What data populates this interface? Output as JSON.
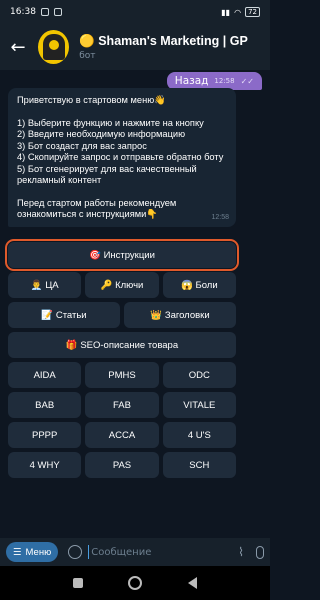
{
  "status": {
    "time": "16:38",
    "battery": "72"
  },
  "header": {
    "title": "🟡 Shaman's Marketing | GP",
    "subtitle": "бот"
  },
  "out_message": {
    "text": "Назад",
    "time": "12:58"
  },
  "in_message": {
    "greeting": "Приветствую в стартовом меню👋",
    "steps": [
      "1) Выберите функцию и нажмите на кнопку",
      "2) Введите необходимую информацию",
      "3) Бот создаст для вас запрос",
      "4) Скопируйте запрос и отправьте обратно боту",
      "5) Бот сгенерирует для вас качественный рекламный контент"
    ],
    "footer": "Перед стартом работы рекомендуем ознакомиться с инструкциями👇",
    "time": "12:58"
  },
  "keyboard": {
    "instructions": "🎯 Инструкции",
    "ca": "👨‍💼 ЦА",
    "keys": "🔑 Ключи",
    "pains": "😱 Боли",
    "articles": "📝 Статьи",
    "headlines": "👑 Заголовки",
    "seo": "🎁 SEO-описание товара",
    "grid": [
      [
        "AIDA",
        "PMHS",
        "ODC"
      ],
      [
        "BAB",
        "FAB",
        "VITALE"
      ],
      [
        "PPPP",
        "ACCA",
        "4 U'S"
      ],
      [
        "4 WHY",
        "PAS",
        "SCH"
      ]
    ]
  },
  "input": {
    "menu_label": "Меню",
    "placeholder": "Сообщение"
  }
}
